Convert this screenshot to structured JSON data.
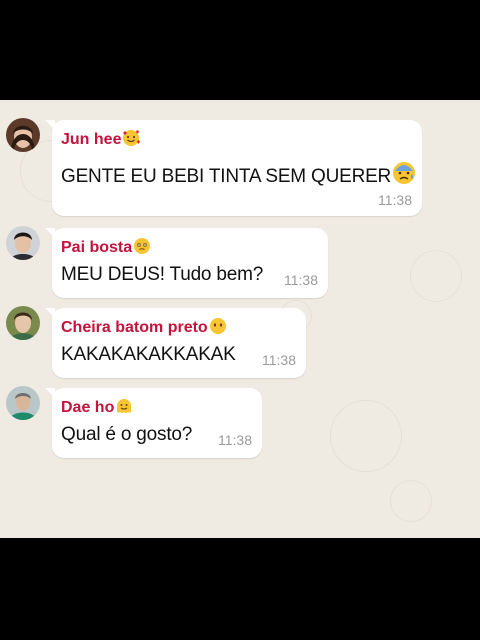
{
  "chat": {
    "messages": [
      {
        "sender": "Jun hee",
        "sender_emoji": "smiling-face-with-hearts",
        "text": "GENTE EU BEBI TINTA SEM QUERER",
        "text_emoji": "anxious-face-with-sweat",
        "time": "11:38"
      },
      {
        "sender": "Pai bosta",
        "sender_emoji": "face-holding-back-tears",
        "text": "MEU DEUS! Tudo bem?",
        "time": "11:38"
      },
      {
        "sender": "Cheira batom preto",
        "sender_emoji": "face-without-mouth",
        "text": "KAKAKAKAKKAKAK",
        "time": "11:38"
      },
      {
        "sender": "Dae ho",
        "sender_emoji": "melting-face",
        "text": "Qual é o gosto?",
        "time": "11:38"
      }
    ]
  },
  "colors": {
    "sender_name": "#c4133c",
    "chat_background": "#efeae2",
    "bubble": "#ffffff",
    "timestamp": "#9a9a9a"
  }
}
